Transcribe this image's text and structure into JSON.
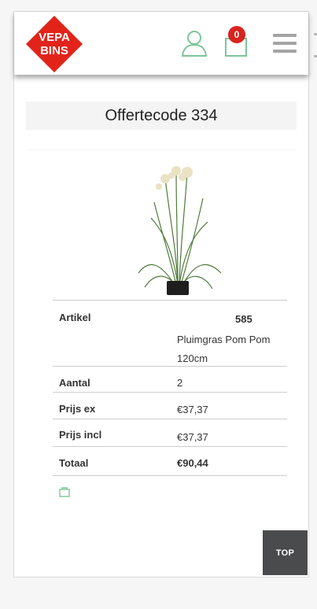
{
  "header": {
    "logo": {
      "line1": "VEPA",
      "line2": "BINS",
      "color": "#e2231a"
    },
    "cart_count": "0",
    "accent_color": "#7fc59a"
  },
  "page": {
    "title": "Offertecode 334"
  },
  "product": {
    "image": "plant-image"
  },
  "details": {
    "artikel_label": "Artikel",
    "artikel_code": "585",
    "artikel_name": "Pluimgras Pom Pom 120cm",
    "aantal_label": "Aantal",
    "aantal_value": "2",
    "prijs_ex_label": "Prijs ex",
    "prijs_ex_value": "€37,37",
    "prijs_incl_label": "Prijs incl",
    "prijs_incl_value": "€37,37",
    "totaal_label": "Totaal",
    "totaal_value": "€90,44"
  },
  "footer": {
    "top_label": "TOP"
  }
}
